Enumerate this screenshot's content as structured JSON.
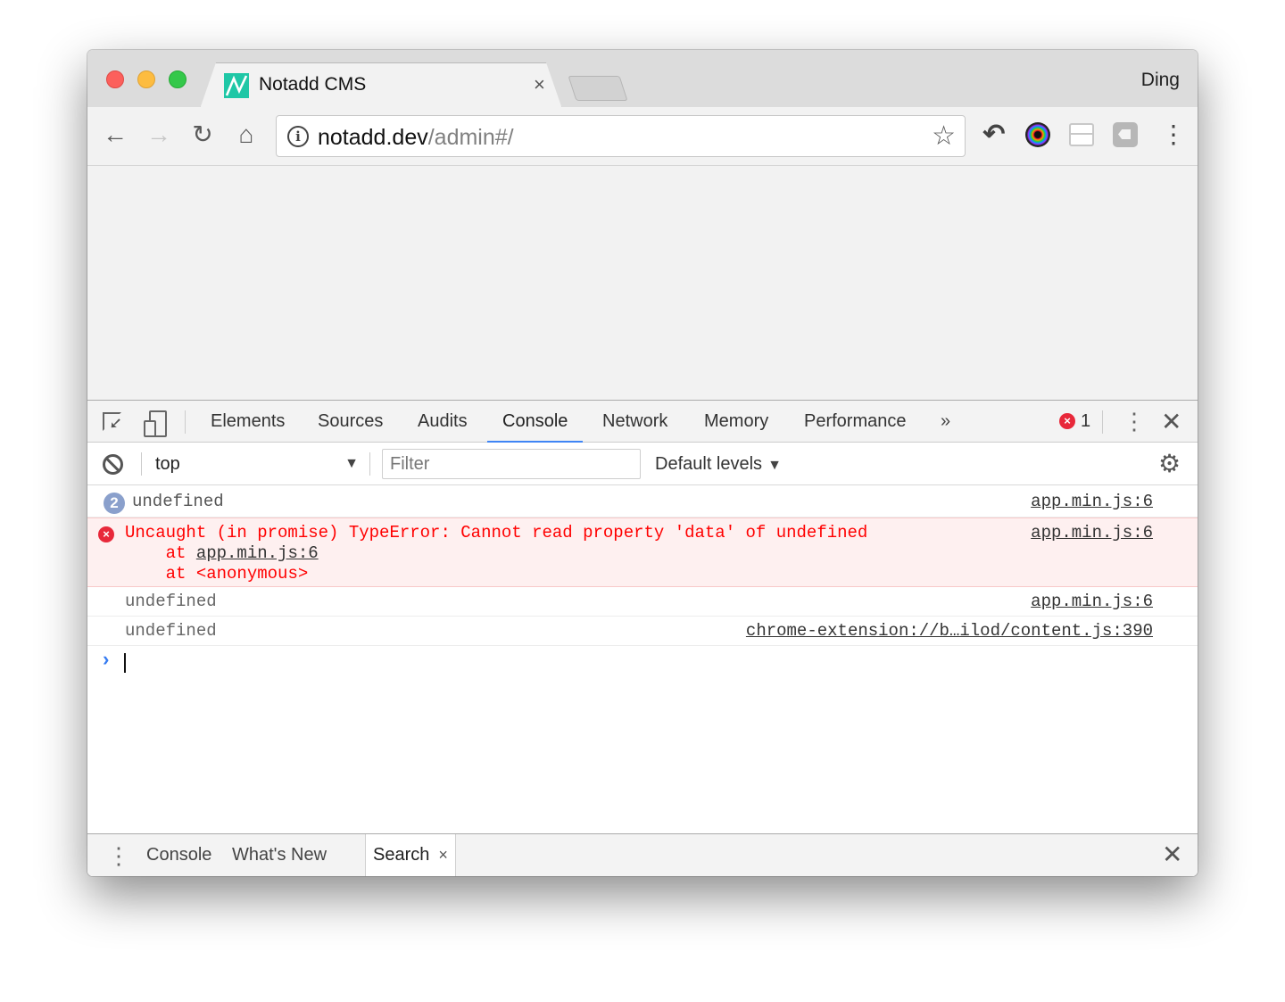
{
  "window": {
    "traffic_lights": [
      "close",
      "minimize",
      "zoom"
    ],
    "profile_name": "Ding"
  },
  "tabs": [
    {
      "title": "Notadd CMS",
      "close_icon": "×",
      "active": true
    }
  ],
  "toolbar": {
    "back_icon": "←",
    "forward_icon": "→",
    "reload_icon": "↻",
    "home_icon": "⌂",
    "info_icon": "i",
    "url_host": "notadd.dev",
    "url_path": "/admin#/",
    "bookmark_icon": "☆",
    "extensions": [
      "undo-extension",
      "color-lens-extension",
      "layout-extension",
      "tag-extension"
    ],
    "undo_icon": "↶",
    "menu_icon": "⋮"
  },
  "devtools": {
    "tabs": [
      "Elements",
      "Sources",
      "Audits",
      "Console",
      "Network",
      "Memory",
      "Performance"
    ],
    "active_tab": "Console",
    "more_tabs_icon": "»",
    "error_count": "1",
    "error_icon": "×",
    "kebab_icon": "⋮",
    "close_icon": "✕",
    "console_toolbar": {
      "context": "top",
      "context_arrow": "▼",
      "filter_placeholder": "Filter",
      "levels": "Default levels",
      "levels_arrow": "▼",
      "gear_icon": "⚙"
    },
    "messages": [
      {
        "type": "log",
        "repeat": "2",
        "text": "undefined",
        "source": "app.min.js:6"
      },
      {
        "type": "error",
        "text": "Uncaught (in promise) TypeError: Cannot read property 'data' of undefined",
        "stack_prefix": "    at ",
        "stack": [
          "app.min.js:6",
          "<anonymous>"
        ],
        "source": "app.min.js:6"
      },
      {
        "type": "log",
        "text": "undefined",
        "source": "app.min.js:6"
      },
      {
        "type": "log",
        "text": "undefined",
        "source": "chrome-extension://b…ilod/content.js:390"
      }
    ],
    "prompt_icon": "›",
    "drawer": {
      "kebab_icon": "⋮",
      "tabs": [
        "Console",
        "What's New",
        "Search"
      ],
      "active_tab": "Search",
      "tab_close_icon": "×",
      "close_icon": "✕"
    }
  },
  "colors": {
    "accent": "#3f85f5",
    "error": "#ff0000",
    "error_bg": "#fef0f0",
    "favicon": "#1fc7a6"
  }
}
